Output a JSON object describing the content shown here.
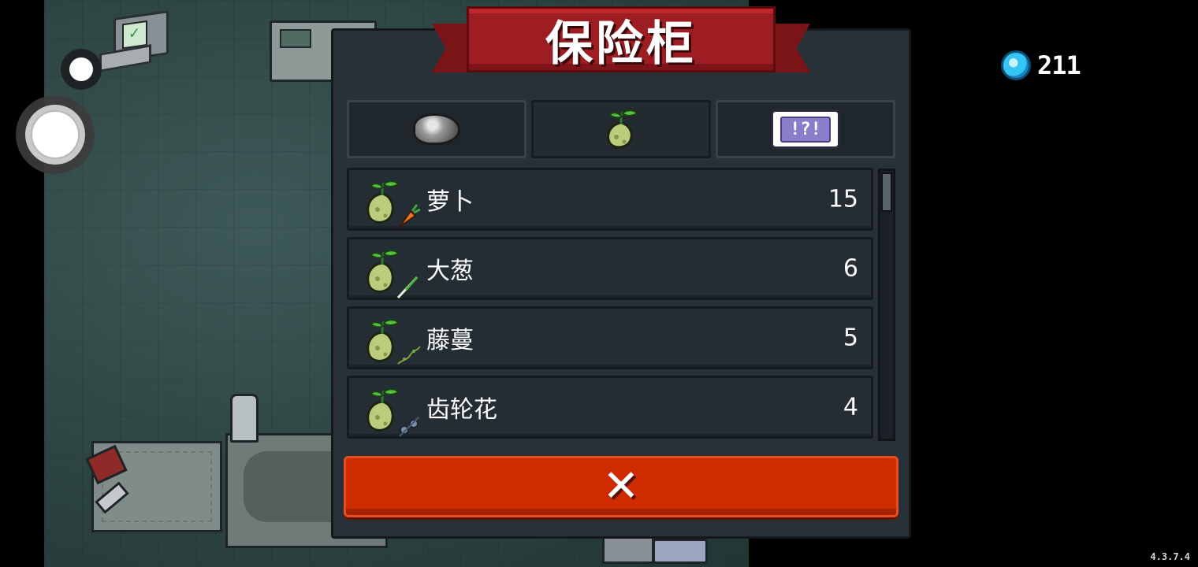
{
  "title": "保险柜",
  "gems": {
    "count": "211",
    "icon": "gem-icon"
  },
  "version": "4.3.7.4",
  "tabs": [
    {
      "name": "ore-tab",
      "icon": "ore-icon",
      "active": false
    },
    {
      "name": "seed-tab",
      "icon": "seed-icon",
      "active": true
    },
    {
      "name": "ticket-tab",
      "icon": "ticket-icon",
      "label": "!?!",
      "active": false
    }
  ],
  "items": [
    {
      "name": "萝卜",
      "count": "15",
      "icon": "carrot-seed-icon"
    },
    {
      "name": "大葱",
      "count": "6",
      "icon": "scallion-seed-icon"
    },
    {
      "name": "藤蔓",
      "count": "5",
      "icon": "vine-seed-icon"
    },
    {
      "name": "齿轮花",
      "count": "4",
      "icon": "gear-flower-seed-icon"
    }
  ],
  "close": {
    "label": "✕",
    "icon": "close-icon"
  },
  "colors": {
    "banner": "#9e1d22",
    "close_button": "#cf2b00",
    "panel": "#293138"
  }
}
